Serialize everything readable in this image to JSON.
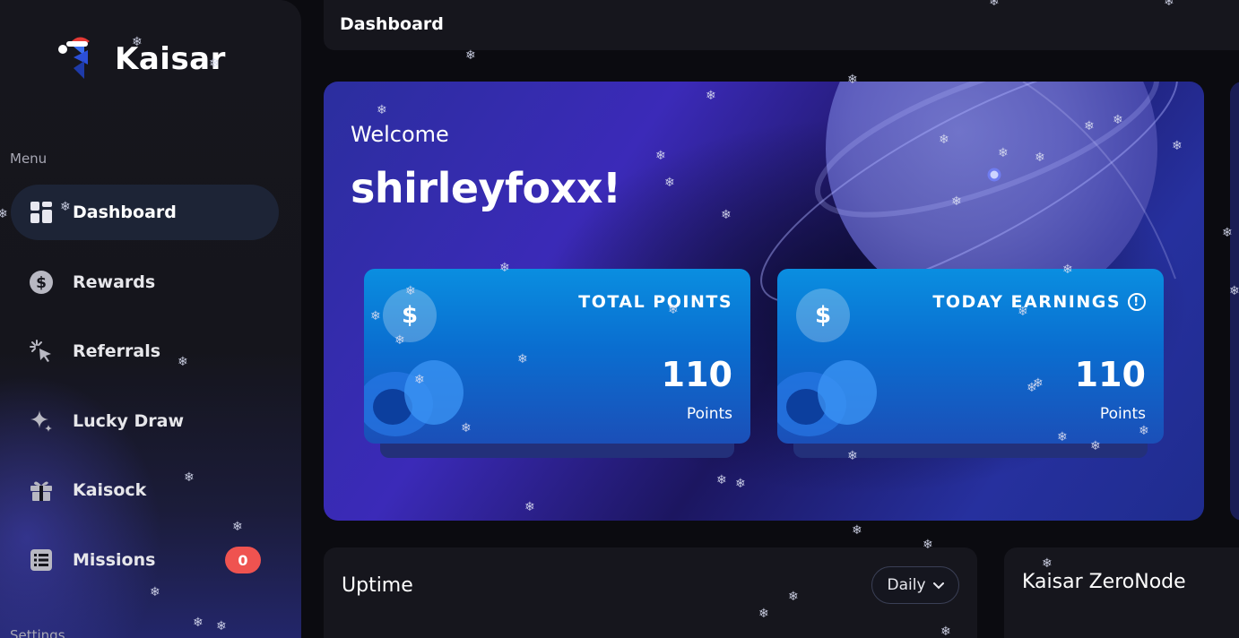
{
  "brand": {
    "name": "Kaisar"
  },
  "sidebar": {
    "menu_label": "Menu",
    "settings_label": "Settings",
    "items": [
      {
        "label": "Dashboard",
        "icon": "dashboard-icon",
        "active": true
      },
      {
        "label": "Rewards",
        "icon": "dollar-coin-icon"
      },
      {
        "label": "Referrals",
        "icon": "cursor-click-icon"
      },
      {
        "label": "Lucky Draw",
        "icon": "sparkle-icon"
      },
      {
        "label": "Kaisock",
        "icon": "gift-icon"
      },
      {
        "label": "Missions",
        "icon": "list-icon",
        "badge": "0"
      }
    ]
  },
  "header": {
    "title": "Dashboard"
  },
  "welcome": {
    "greeting": "Welcome",
    "username": "shirleyfoxx!"
  },
  "cards": [
    {
      "title": "TOTAL POINTS",
      "value": "110",
      "unit": "Points",
      "currency": "$"
    },
    {
      "title": "TODAY EARNINGS",
      "value": "110",
      "unit": "Points",
      "currency": "$",
      "info": "!"
    }
  ],
  "uptime": {
    "title": "Uptime",
    "period": "Daily"
  },
  "zeronode": {
    "title": "Kaisar ZeroNode"
  },
  "colors": {
    "accent": "#0a8ee0",
    "badge": "#ef5350",
    "background": "#0b0b10"
  }
}
